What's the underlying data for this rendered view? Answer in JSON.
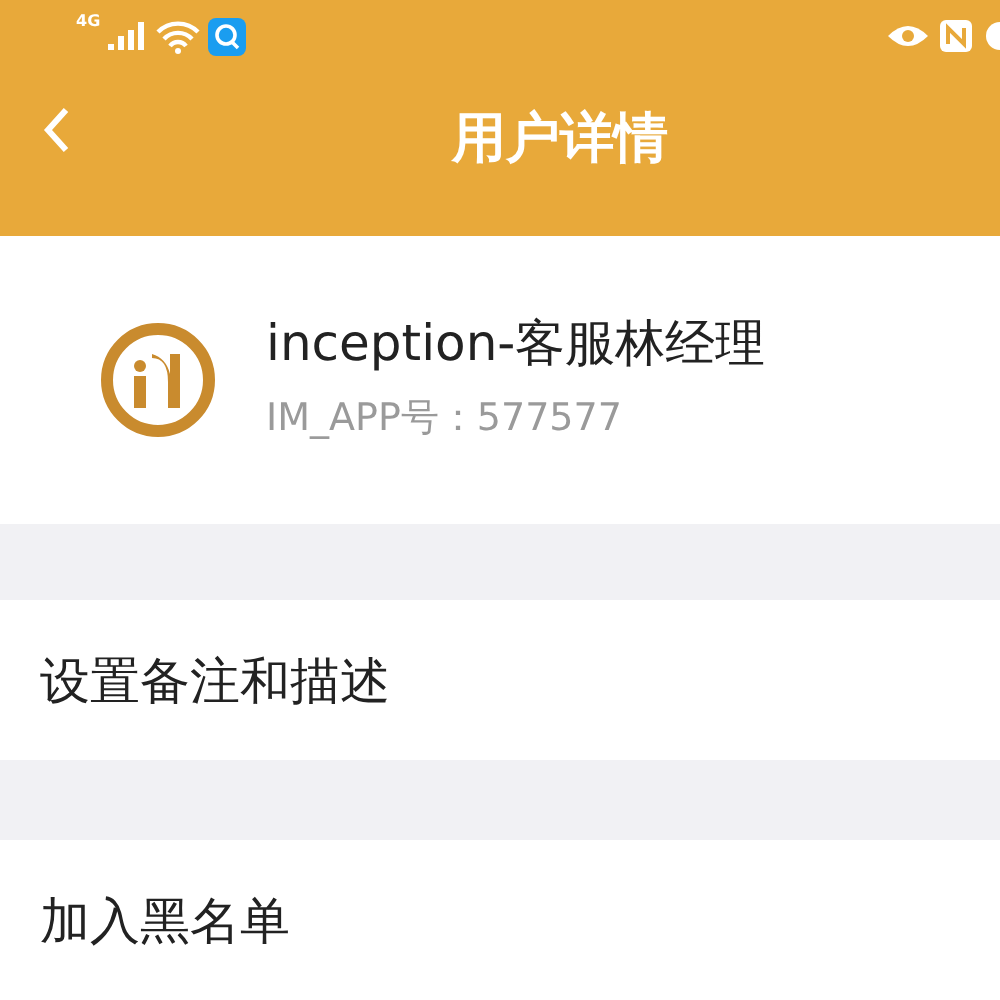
{
  "status_bar": {
    "network": "4G"
  },
  "header": {
    "title": "用户详情"
  },
  "profile": {
    "name": "inception-客服林经理",
    "account": "IM_APP号：577577"
  },
  "menu_items": [
    {
      "label": "设置备注和描述"
    },
    {
      "label": "加入黑名单"
    }
  ]
}
